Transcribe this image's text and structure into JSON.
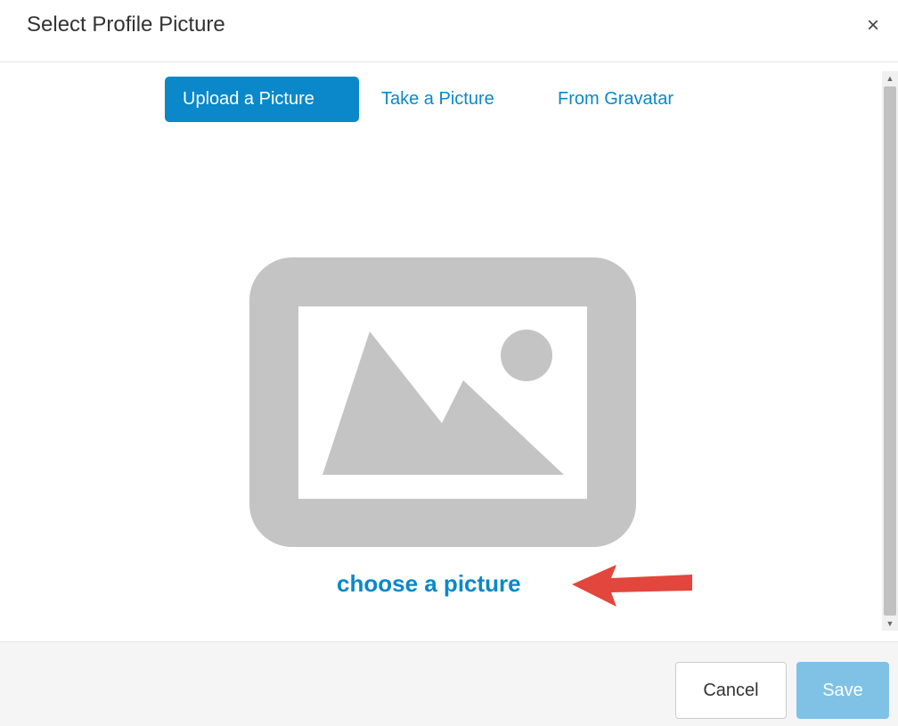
{
  "dialog": {
    "title": "Select Profile Picture",
    "close_symbol": "×"
  },
  "tabs": [
    {
      "label": "Upload a Picture",
      "active": true
    },
    {
      "label": "Take a Picture",
      "active": false
    },
    {
      "label": "From Gravatar",
      "active": false
    }
  ],
  "upload": {
    "placeholder_icon": "image-placeholder-icon",
    "choose_link": "choose a picture",
    "annotation": "red-arrow-icon"
  },
  "footer": {
    "cancel_label": "Cancel",
    "save_label": "Save"
  },
  "colors": {
    "accent": "#0a88c9",
    "save_disabled": "#7fc2e6",
    "placeholder_gray": "#c4c4c4",
    "arrow_red": "#e2463c"
  }
}
